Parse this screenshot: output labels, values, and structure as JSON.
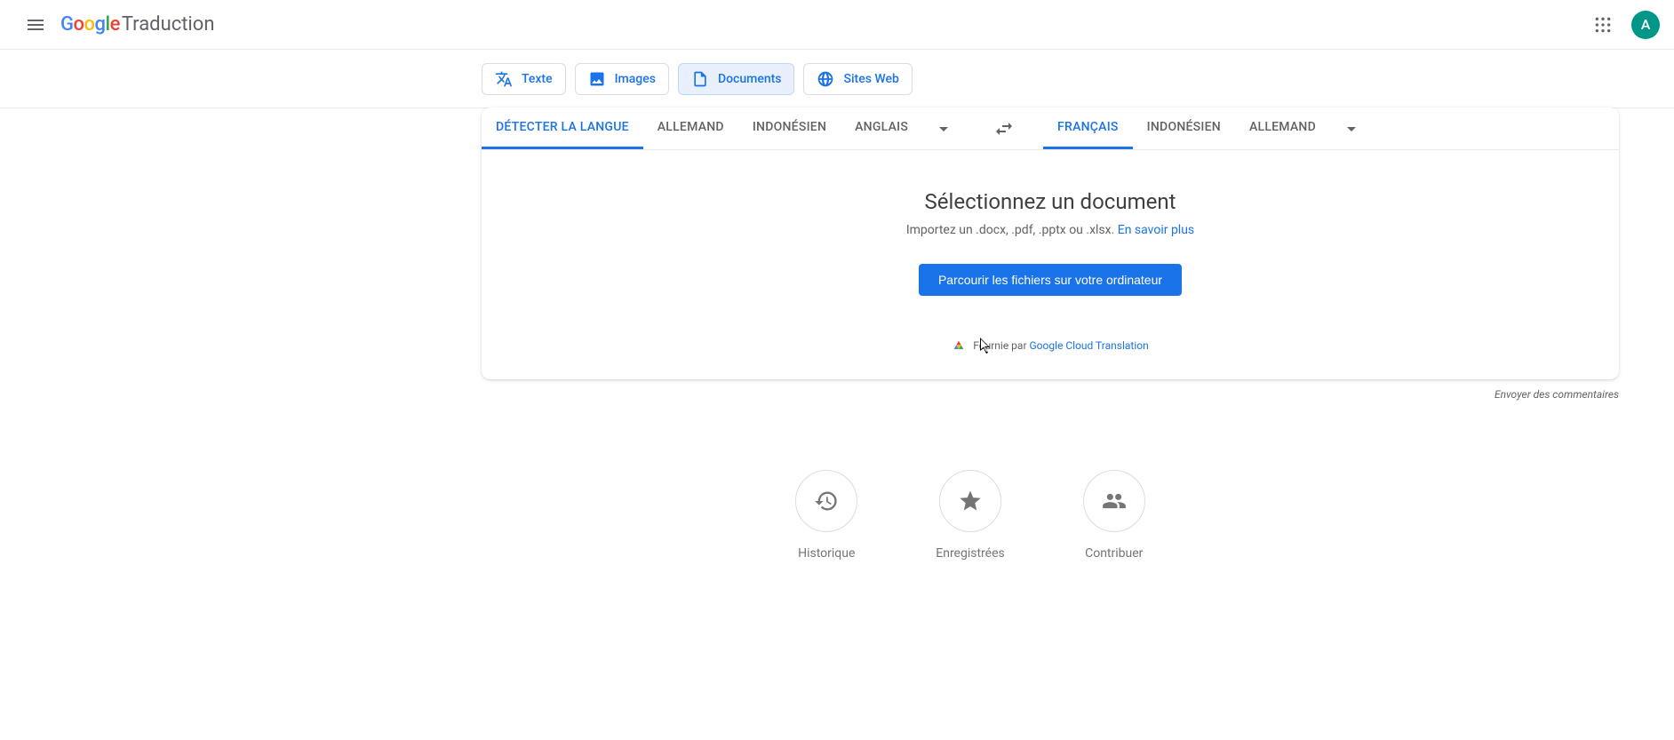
{
  "header": {
    "product": "Traduction",
    "avatar_initial": "A"
  },
  "mode_tabs": {
    "text": "Texte",
    "images": "Images",
    "documents": "Documents",
    "websites": "Sites Web"
  },
  "source_langs": {
    "detect": "DÉTECTER LA LANGUE",
    "l1": "ALLEMAND",
    "l2": "INDONÉSIEN",
    "l3": "ANGLAIS"
  },
  "target_langs": {
    "l1": "FRANÇAIS",
    "l2": "INDONÉSIEN",
    "l3": "ALLEMAND"
  },
  "doc_panel": {
    "title": "Sélectionnez un document",
    "subtitle": "Importez un .docx, .pdf, .pptx ou .xlsx. ",
    "learn_more": "En savoir plus",
    "browse_button": "Parcourir les fichiers sur votre ordinateur",
    "powered_prefix": "Fournie par ",
    "powered_link": "Google Cloud Translation"
  },
  "feedback": "Envoyer des commentaires",
  "quick": {
    "history": "Historique",
    "saved": "Enregistrées",
    "contribute": "Contribuer"
  }
}
